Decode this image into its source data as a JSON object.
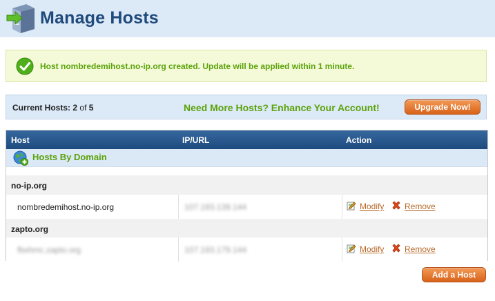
{
  "header": {
    "title": "Manage Hosts",
    "logo_icon": "server-stack-icon"
  },
  "notice": {
    "icon": "checkmark-icon",
    "message": "Host nombredemihost.no-ip.org created. Update will be applied within 1 minute."
  },
  "hosts_bar": {
    "label": "Current Hosts:",
    "current": "2",
    "of_text": "of",
    "max": "5",
    "promo": "Need More Hosts? Enhance Your Account!",
    "upgrade_label": "Upgrade Now!"
  },
  "table": {
    "columns": [
      "Host",
      "IP/URL",
      "Action"
    ],
    "group_label": "Hosts By Domain",
    "domains": [
      {
        "name": "no-ip.org",
        "hosts": [
          {
            "host": "nombredemihost.no-ip.org",
            "host_blurred": false,
            "ip": "107.193.139.144",
            "ip_blurred": true
          }
        ]
      },
      {
        "name": "zapto.org",
        "hosts": [
          {
            "host": "fbxhmc.zapto.org",
            "host_blurred": true,
            "ip": "107.193.179.144",
            "ip_blurred": true
          }
        ]
      }
    ],
    "modify_label": "Modify",
    "remove_label": "Remove"
  },
  "add_host_label": "Add a Host",
  "colors": {
    "accent_green": "#5ba20a",
    "title_blue": "#1f4a7c",
    "button_orange": "#d8621a"
  }
}
